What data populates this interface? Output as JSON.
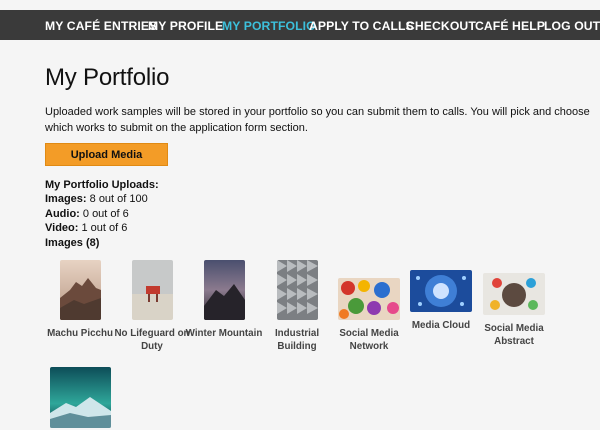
{
  "nav": {
    "items": [
      {
        "label": "MY CAFÉ ENTRIES"
      },
      {
        "label": "MY PROFILE"
      },
      {
        "label": "MY PORTFOLIO"
      },
      {
        "label": "APPLY TO CALLS"
      },
      {
        "label": "CHECKOUT"
      },
      {
        "label": "CAFÉ HELP"
      },
      {
        "label": "LOG OUT"
      }
    ],
    "active_color": "#3cc0dc"
  },
  "page": {
    "title": "My Portfolio",
    "intro": "Uploaded work samples will be stored in your portfolio so you can submit them to calls. You will pick and choose which works to submit on the application form section.",
    "upload_button": "Upload Media"
  },
  "stats": {
    "heading": "My Portfolio Uploads:",
    "images_label": "Images:",
    "images_value": "8 out of 100",
    "audio_label": "Audio:",
    "audio_value": "0 out of 6",
    "video_label": "Video:",
    "video_value": "1 out of 6",
    "images_section": "Images (8)"
  },
  "images": [
    {
      "caption": "Machu Picchu"
    },
    {
      "caption": "No Lifeguard on Duty"
    },
    {
      "caption": "Winter Mountain"
    },
    {
      "caption": "Industrial Building"
    },
    {
      "caption": "Social Media Network"
    },
    {
      "caption": "Media Cloud"
    },
    {
      "caption": "Social Media Abstract"
    },
    {
      "caption": ""
    }
  ]
}
